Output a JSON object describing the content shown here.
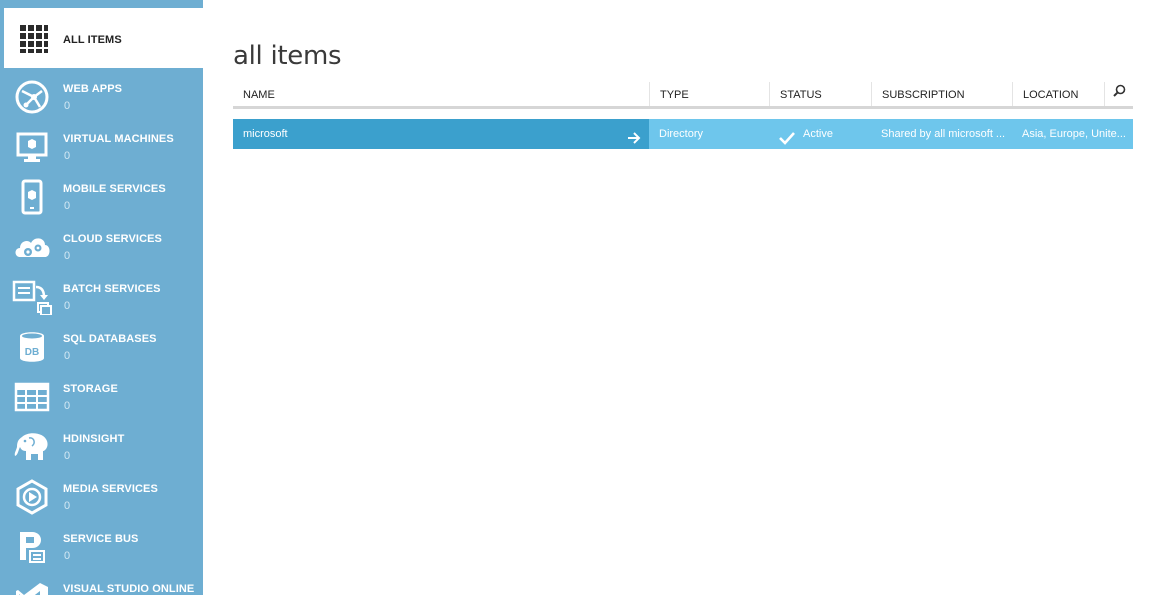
{
  "sidebar": {
    "items": [
      {
        "label": "ALL ITEMS",
        "count": "",
        "icon": "grid-icon"
      },
      {
        "label": "WEB APPS",
        "count": "0",
        "icon": "web-apps-icon"
      },
      {
        "label": "VIRTUAL MACHINES",
        "count": "0",
        "icon": "virtual-machine-icon"
      },
      {
        "label": "MOBILE SERVICES",
        "count": "0",
        "icon": "mobile-icon"
      },
      {
        "label": "CLOUD SERVICES",
        "count": "0",
        "icon": "cloud-gears-icon"
      },
      {
        "label": "BATCH SERVICES",
        "count": "0",
        "icon": "batch-icon"
      },
      {
        "label": "SQL DATABASES",
        "count": "0",
        "icon": "database-icon"
      },
      {
        "label": "STORAGE",
        "count": "0",
        "icon": "storage-table-icon"
      },
      {
        "label": "HDINSIGHT",
        "count": "0",
        "icon": "elephant-icon"
      },
      {
        "label": "MEDIA SERVICES",
        "count": "0",
        "icon": "media-play-icon"
      },
      {
        "label": "SERVICE BUS",
        "count": "0",
        "icon": "service-bus-icon"
      },
      {
        "label": "VISUAL STUDIO ONLINE",
        "count": "",
        "icon": "visual-studio-icon"
      }
    ]
  },
  "main": {
    "title": "all items",
    "columns": [
      "NAME",
      "TYPE",
      "STATUS",
      "SUBSCRIPTION",
      "LOCATION"
    ],
    "rows": [
      {
        "name": "microsoft",
        "type": "Directory",
        "status": "Active",
        "subscription": "Shared by all microsoft ...",
        "location": "Asia, Europe, Unite..."
      }
    ]
  },
  "colors": {
    "sidebar_bg": "#6eaed2",
    "row_selected": "#3ba0cd",
    "row_highlight": "#6ec6ec"
  }
}
